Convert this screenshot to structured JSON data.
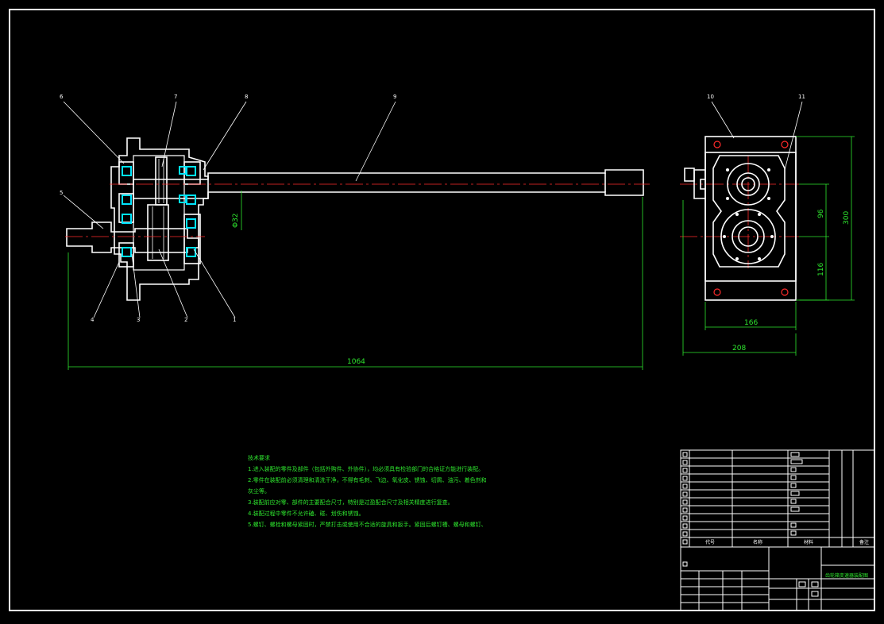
{
  "colors": {
    "background": "#000000",
    "outline": "#ffffff",
    "dimension": "#2ee62e",
    "centerline": "#ff2a2a",
    "bearing": "#00e5ff"
  },
  "balloons": [
    "1",
    "2",
    "3",
    "4",
    "5",
    "6",
    "7",
    "8",
    "9",
    "10",
    "11"
  ],
  "dimensions": {
    "overall_length": "1064",
    "shaft_diameter": "Φ32",
    "center_distance": "96",
    "lower_height": "116",
    "housing_height": "300",
    "housing_width_inner": "166",
    "housing_width_outer": "208"
  },
  "technical_requirements": {
    "title": "技术要求",
    "lines": [
      "1.进入装配的零件及部件（包括外购件、外协件），均必须具有检验部门的合格证方能进行装配。",
      "2.零件在装配前必须清理和清洗干净，不得有毛刺、飞边、氧化皮、锈蚀、切屑、油污、着色剂和",
      "灰尘等。",
      "3.装配前应对零、部件的主要配合尺寸，特别是过盈配合尺寸及相关精度进行复查。",
      "4.装配过程中零件不允许磕、碰、划伤和锈蚀。",
      "5.螺钉、螺栓和螺母紧固时，严禁打击或使用不合适的旋具和扳手。紧固后螺钉槽、螺母和螺钉、"
    ]
  },
  "title_block": {
    "parts": [
      {
        "code": "",
        "name": "",
        "qty": "",
        "material": ""
      },
      {
        "code": "",
        "name": "",
        "qty": "",
        "material": ""
      },
      {
        "code": "",
        "name": "",
        "qty": "",
        "material": ""
      },
      {
        "code": "",
        "name": "",
        "qty": "",
        "material": ""
      },
      {
        "code": "",
        "name": "",
        "qty": "",
        "material": ""
      },
      {
        "code": "",
        "name": "",
        "qty": "",
        "material": ""
      },
      {
        "code": "",
        "name": "",
        "qty": "",
        "material": ""
      },
      {
        "code": "",
        "name": "",
        "qty": "",
        "material": ""
      },
      {
        "code": "",
        "name": "",
        "qty": "",
        "material": ""
      },
      {
        "code": "",
        "name": "",
        "qty": "",
        "material": ""
      },
      {
        "code": "",
        "name": "",
        "qty": "",
        "material": ""
      }
    ],
    "header": {
      "seq": "",
      "code": "代号",
      "name": "名称",
      "qty": "",
      "material": "材料",
      "unit": "",
      "total": "",
      "remark": "备注"
    },
    "drawing_name": "齿轮箱变速器装配图"
  }
}
